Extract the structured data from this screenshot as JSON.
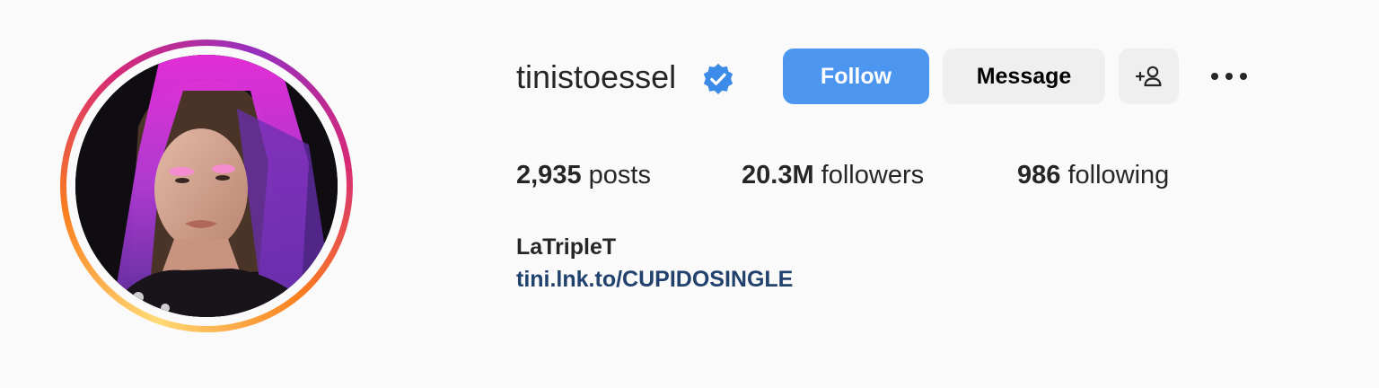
{
  "profile": {
    "username": "tinistoessel",
    "verified_icon": "verified-badge-icon",
    "avatar_alt": "profile photo"
  },
  "actions": {
    "follow_label": "Follow",
    "message_label": "Message",
    "suggest_icon": "add-person-icon",
    "more_icon": "more-options-icon"
  },
  "stats": {
    "posts_count": "2,935",
    "posts_label": "posts",
    "followers_count": "20.3M",
    "followers_label": "followers",
    "following_count": "986",
    "following_label": "following"
  },
  "bio": {
    "name": "LaTripleT",
    "link": "tini.lnk.to/CUPIDOSINGLE"
  },
  "colors": {
    "accent": "#4d96ef",
    "link": "#22426e",
    "background": "#fafafa",
    "secondary_button": "#efefef"
  }
}
